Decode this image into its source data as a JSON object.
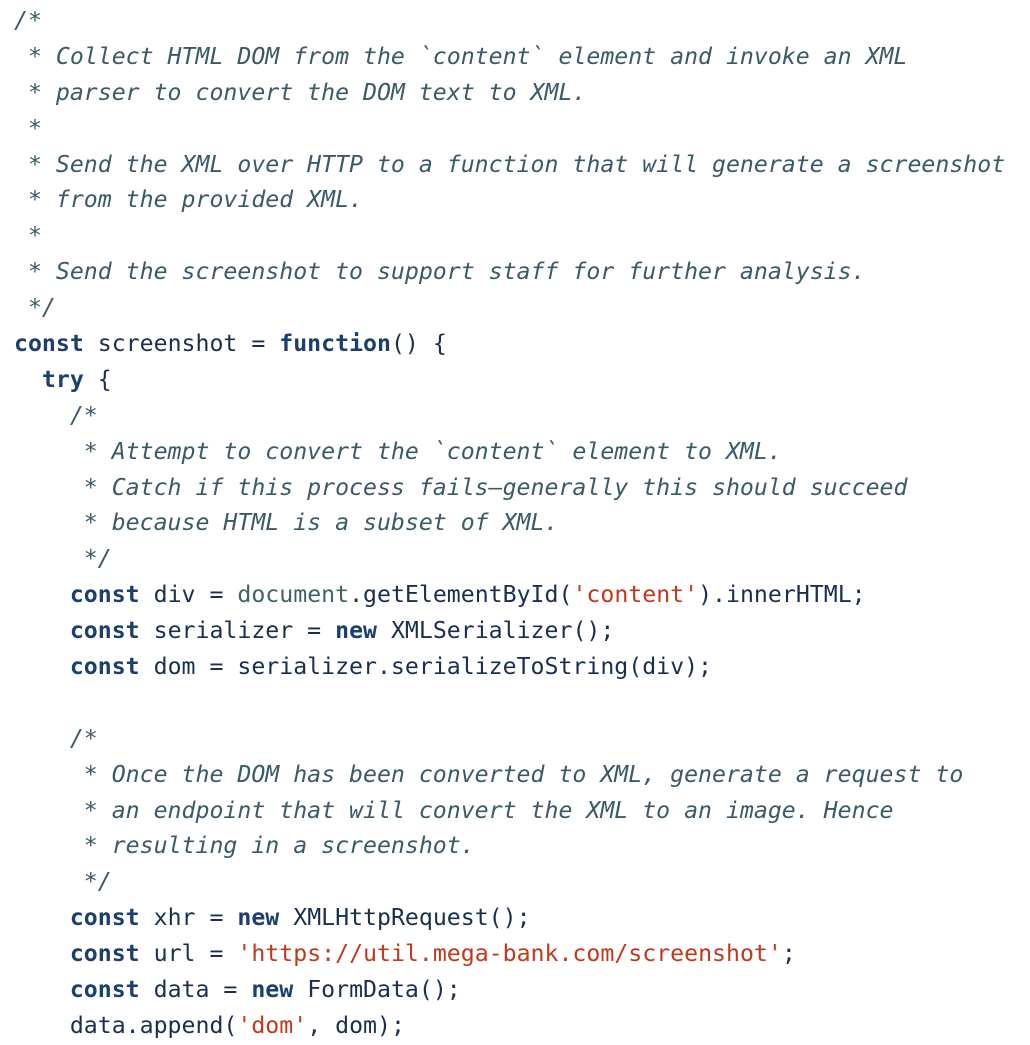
{
  "code": {
    "lines": [
      [
        {
          "t": "/*",
          "c": "comment"
        }
      ],
      [
        {
          "t": " * Collect HTML DOM from the `content` element and invoke an XML",
          "c": "comment"
        }
      ],
      [
        {
          "t": " * parser to convert the DOM text to XML.",
          "c": "comment"
        }
      ],
      [
        {
          "t": " *",
          "c": "comment"
        }
      ],
      [
        {
          "t": " * Send the XML over HTTP to a function that will generate a screenshot",
          "c": "comment"
        }
      ],
      [
        {
          "t": " * from the provided XML.",
          "c": "comment"
        }
      ],
      [
        {
          "t": " *",
          "c": "comment"
        }
      ],
      [
        {
          "t": " * Send the screenshot to support staff for further analysis.",
          "c": "comment"
        }
      ],
      [
        {
          "t": " */",
          "c": "comment"
        }
      ],
      [
        {
          "t": "const",
          "c": "kw"
        },
        {
          "t": " screenshot = ",
          "c": "plain"
        },
        {
          "t": "function",
          "c": "kw"
        },
        {
          "t": "() {",
          "c": "punc"
        }
      ],
      [
        {
          "t": "  ",
          "c": "plain"
        },
        {
          "t": "try",
          "c": "kw"
        },
        {
          "t": " {",
          "c": "punc"
        }
      ],
      [
        {
          "t": "    /*",
          "c": "comment"
        }
      ],
      [
        {
          "t": "     * Attempt to convert the `content` element to XML.",
          "c": "comment"
        }
      ],
      [
        {
          "t": "     * Catch if this process fails—generally this should succeed",
          "c": "comment"
        }
      ],
      [
        {
          "t": "     * because HTML is a subset of XML.",
          "c": "comment"
        }
      ],
      [
        {
          "t": "     */",
          "c": "comment"
        }
      ],
      [
        {
          "t": "    ",
          "c": "plain"
        },
        {
          "t": "const",
          "c": "kw"
        },
        {
          "t": " div = ",
          "c": "plain"
        },
        {
          "t": "document",
          "c": "obj"
        },
        {
          "t": ".getElementById(",
          "c": "plain"
        },
        {
          "t": "'content'",
          "c": "str"
        },
        {
          "t": ").innerHTML;",
          "c": "plain"
        }
      ],
      [
        {
          "t": "    ",
          "c": "plain"
        },
        {
          "t": "const",
          "c": "kw"
        },
        {
          "t": " serializer = ",
          "c": "plain"
        },
        {
          "t": "new",
          "c": "kw"
        },
        {
          "t": " XMLSerializer();",
          "c": "plain"
        }
      ],
      [
        {
          "t": "    ",
          "c": "plain"
        },
        {
          "t": "const",
          "c": "kw"
        },
        {
          "t": " dom = serializer.serializeToString(div);",
          "c": "plain"
        }
      ],
      [
        {
          "t": "",
          "c": "plain"
        }
      ],
      [
        {
          "t": "    /*",
          "c": "comment"
        }
      ],
      [
        {
          "t": "     * Once the DOM has been converted to XML, generate a request to",
          "c": "comment"
        }
      ],
      [
        {
          "t": "     * an endpoint that will convert the XML to an image. Hence",
          "c": "comment"
        }
      ],
      [
        {
          "t": "     * resulting in a screenshot.",
          "c": "comment"
        }
      ],
      [
        {
          "t": "     */",
          "c": "comment"
        }
      ],
      [
        {
          "t": "    ",
          "c": "plain"
        },
        {
          "t": "const",
          "c": "kw"
        },
        {
          "t": " xhr = ",
          "c": "plain"
        },
        {
          "t": "new",
          "c": "kw"
        },
        {
          "t": " XMLHttpRequest();",
          "c": "plain"
        }
      ],
      [
        {
          "t": "    ",
          "c": "plain"
        },
        {
          "t": "const",
          "c": "kw"
        },
        {
          "t": " url = ",
          "c": "plain"
        },
        {
          "t": "'https://util.mega-bank.com/screenshot'",
          "c": "str"
        },
        {
          "t": ";",
          "c": "plain"
        }
      ],
      [
        {
          "t": "    ",
          "c": "plain"
        },
        {
          "t": "const",
          "c": "kw"
        },
        {
          "t": " data = ",
          "c": "plain"
        },
        {
          "t": "new",
          "c": "kw"
        },
        {
          "t": " FormData();",
          "c": "plain"
        }
      ],
      [
        {
          "t": "    data.append(",
          "c": "plain"
        },
        {
          "t": "'dom'",
          "c": "str"
        },
        {
          "t": ", dom);",
          "c": "plain"
        }
      ]
    ]
  }
}
